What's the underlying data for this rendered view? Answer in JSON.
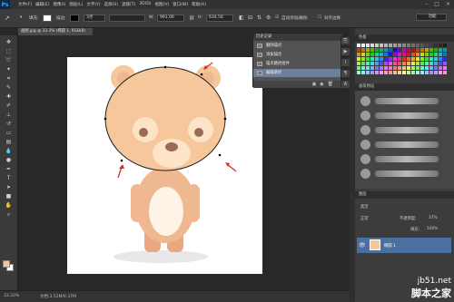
{
  "app": {
    "logo": "Ps"
  },
  "menu": [
    "文件(F)",
    "编辑(E)",
    "图像(I)",
    "图层(L)",
    "文字(Y)",
    "选择(S)",
    "滤镜(T)",
    "3D(D)",
    "视图(V)",
    "窗口(W)",
    "帮助(H)"
  ],
  "options": {
    "fill_label": "填充:",
    "stroke_label": "描边:",
    "stroke_width": "3点",
    "w_label": "W:",
    "w_value": "991.06",
    "h_label": "H:",
    "h_value": "634.56",
    "auto_add_delete": "自动添加/删除",
    "align_edges": "对齐边缘",
    "workspace": "功能"
  },
  "document": {
    "tab": "画图.jpg @ 33.3% (椭圆 1, RGB/8)"
  },
  "history": {
    "title": "历史记录",
    "items": [
      "删除锚点",
      "添加锚点",
      "锚点路径组件",
      "编辑路径"
    ]
  },
  "panels": {
    "swatches_title": "色板",
    "brushes_title": "画笔预设",
    "layers_title": "图层",
    "layers_kind": "类型",
    "blend_mode": "正常",
    "opacity_label": "不透明度:",
    "opacity_value": "37%",
    "fill_label": "填充:",
    "fill_value": "100%",
    "layer_name": "椭圆 1"
  },
  "status": {
    "zoom": "33.33%",
    "doc": "文档:3.52M/9.37M"
  },
  "watermark": {
    "line1": "jb51.net",
    "line2": "脚本之家"
  },
  "colors": {
    "foreground": "#f5c79a",
    "background": "#ffffff",
    "bear": "#f5c79a",
    "bear_dark": "#e9a882"
  }
}
